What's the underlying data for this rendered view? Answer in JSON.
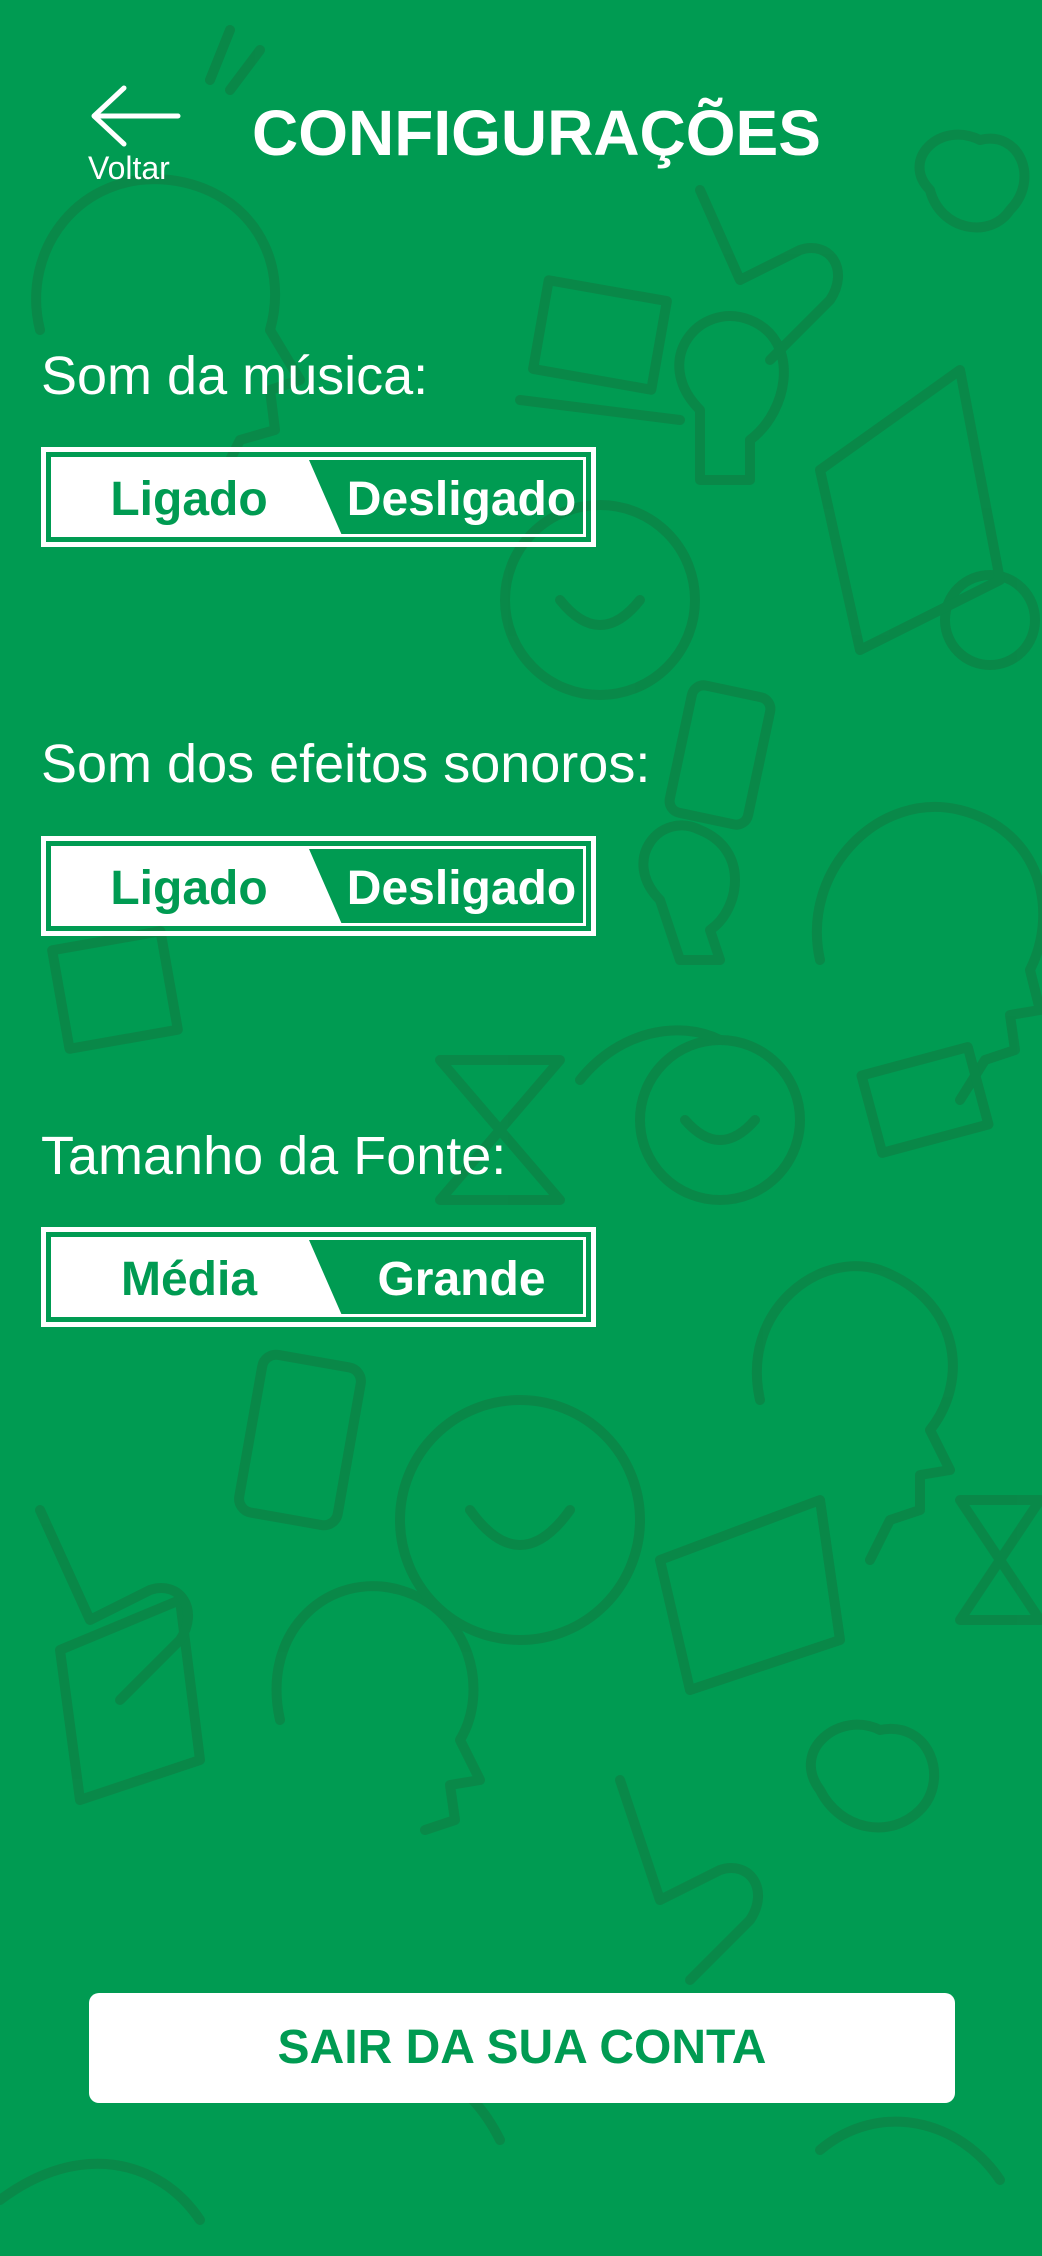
{
  "colors": {
    "background": "#009b52",
    "accent": "#ffffff",
    "pattern": "#0a8748"
  },
  "header": {
    "back_icon": "arrow-left-icon",
    "back_label": "Voltar",
    "title": "CONFIGURAÇÕES"
  },
  "settings": [
    {
      "label": "Som da música:",
      "options": [
        "Ligado",
        "Desligado"
      ],
      "selected": "Ligado"
    },
    {
      "label": "Som dos efeitos sonoros:",
      "options": [
        "Ligado",
        "Desligado"
      ],
      "selected": "Ligado"
    },
    {
      "label": "Tamanho da Fonte:",
      "options": [
        "Média",
        "Grande"
      ],
      "selected": "Média"
    }
  ],
  "logout": {
    "label": "SAIR DA SUA CONTA"
  },
  "background_icons": [
    "head-outline-icon",
    "pointing-hand-icon",
    "brain-icon",
    "laptop-icon",
    "lightbulb-icon",
    "smiley-icon",
    "book-icon",
    "phone-icon",
    "hourglass-icon"
  ]
}
